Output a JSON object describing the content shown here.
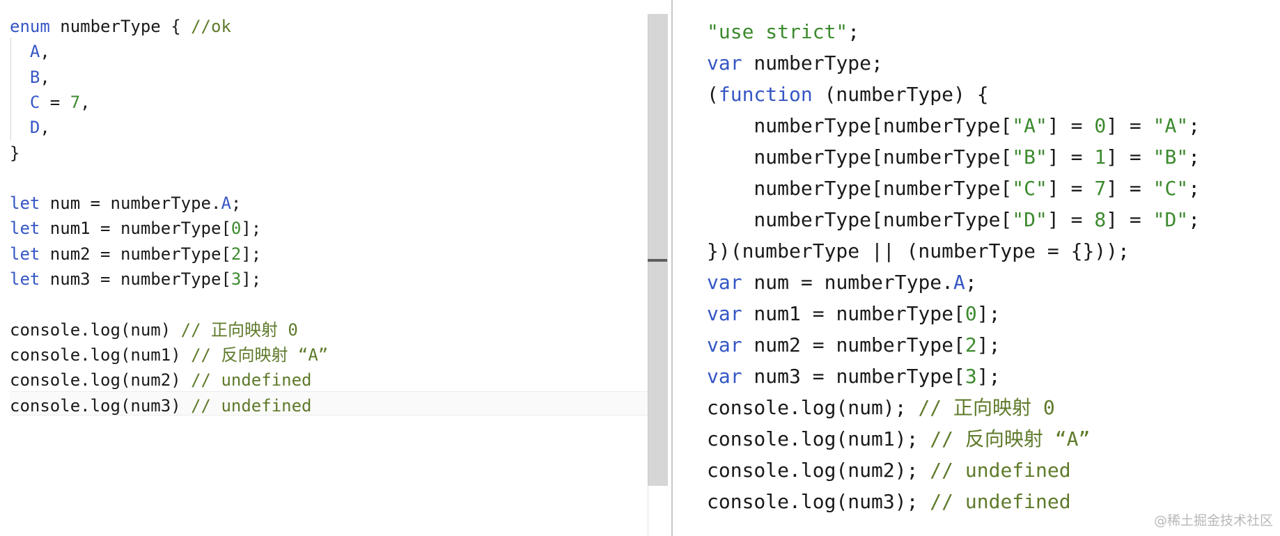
{
  "source_editor": {
    "lines": [
      [
        {
          "t": "enum",
          "c": "kw"
        },
        {
          "t": " numberType { "
        },
        {
          "t": "//ok",
          "c": "cm"
        }
      ],
      [
        {
          "t": "  "
        },
        {
          "t": "A",
          "c": "kw"
        },
        {
          "t": ","
        }
      ],
      [
        {
          "t": "  "
        },
        {
          "t": "B",
          "c": "kw"
        },
        {
          "t": ","
        }
      ],
      [
        {
          "t": "  "
        },
        {
          "t": "C",
          "c": "kw"
        },
        {
          "t": " = "
        },
        {
          "t": "7",
          "c": "num"
        },
        {
          "t": ","
        }
      ],
      [
        {
          "t": "  "
        },
        {
          "t": "D",
          "c": "kw"
        },
        {
          "t": ","
        }
      ],
      [
        {
          "t": "}"
        }
      ],
      [],
      [
        {
          "t": "let",
          "c": "kw"
        },
        {
          "t": " num = numberType."
        },
        {
          "t": "A",
          "c": "mem"
        },
        {
          "t": ";"
        }
      ],
      [
        {
          "t": "let",
          "c": "kw"
        },
        {
          "t": " num1 = numberType["
        },
        {
          "t": "0",
          "c": "num"
        },
        {
          "t": "];"
        }
      ],
      [
        {
          "t": "let",
          "c": "kw"
        },
        {
          "t": " num2 = numberType["
        },
        {
          "t": "2",
          "c": "num"
        },
        {
          "t": "];"
        }
      ],
      [
        {
          "t": "let",
          "c": "kw"
        },
        {
          "t": " num3 = numberType["
        },
        {
          "t": "3",
          "c": "num"
        },
        {
          "t": "];"
        }
      ],
      [],
      [
        {
          "t": "console.log(num) "
        },
        {
          "t": "// 正向映射 0",
          "c": "cm"
        }
      ],
      [
        {
          "t": "console.log(num1) "
        },
        {
          "t": "// 反向映射 “A”",
          "c": "cm"
        }
      ],
      [
        {
          "t": "console.log(num2) "
        },
        {
          "t": "// undefined",
          "c": "cm"
        }
      ],
      [
        {
          "t": "console.log(num3) "
        },
        {
          "t": "// undefined",
          "c": "cm"
        }
      ]
    ]
  },
  "compiled_output": {
    "lines": [
      [
        {
          "t": "\"use strict\"",
          "c": "str"
        },
        {
          "t": ";"
        }
      ],
      [
        {
          "t": "var",
          "c": "kw"
        },
        {
          "t": " numberType;"
        }
      ],
      [
        {
          "t": "("
        },
        {
          "t": "function",
          "c": "kw"
        },
        {
          "t": " (numberType) {"
        }
      ],
      [
        {
          "t": "    numberType[numberType["
        },
        {
          "t": "\"A\"",
          "c": "str"
        },
        {
          "t": "] = "
        },
        {
          "t": "0",
          "c": "num"
        },
        {
          "t": "] = "
        },
        {
          "t": "\"A\"",
          "c": "str"
        },
        {
          "t": ";"
        }
      ],
      [
        {
          "t": "    numberType[numberType["
        },
        {
          "t": "\"B\"",
          "c": "str"
        },
        {
          "t": "] = "
        },
        {
          "t": "1",
          "c": "num"
        },
        {
          "t": "] = "
        },
        {
          "t": "\"B\"",
          "c": "str"
        },
        {
          "t": ";"
        }
      ],
      [
        {
          "t": "    numberType[numberType["
        },
        {
          "t": "\"C\"",
          "c": "str"
        },
        {
          "t": "] = "
        },
        {
          "t": "7",
          "c": "num"
        },
        {
          "t": "] = "
        },
        {
          "t": "\"C\"",
          "c": "str"
        },
        {
          "t": ";"
        }
      ],
      [
        {
          "t": "    numberType[numberType["
        },
        {
          "t": "\"D\"",
          "c": "str"
        },
        {
          "t": "] = "
        },
        {
          "t": "8",
          "c": "num"
        },
        {
          "t": "] = "
        },
        {
          "t": "\"D\"",
          "c": "str"
        },
        {
          "t": ";"
        }
      ],
      [
        {
          "t": "})(numberType || (numberType = {}));"
        }
      ],
      [
        {
          "t": "var",
          "c": "kw"
        },
        {
          "t": " num = numberType."
        },
        {
          "t": "A",
          "c": "mem"
        },
        {
          "t": ";"
        }
      ],
      [
        {
          "t": "var",
          "c": "kw"
        },
        {
          "t": " num1 = numberType["
        },
        {
          "t": "0",
          "c": "num"
        },
        {
          "t": "];"
        }
      ],
      [
        {
          "t": "var",
          "c": "kw"
        },
        {
          "t": " num2 = numberType["
        },
        {
          "t": "2",
          "c": "num"
        },
        {
          "t": "];"
        }
      ],
      [
        {
          "t": "var",
          "c": "kw"
        },
        {
          "t": " num3 = numberType["
        },
        {
          "t": "3",
          "c": "num"
        },
        {
          "t": "];"
        }
      ],
      [
        {
          "t": "console.log(num); "
        },
        {
          "t": "// 正向映射 0",
          "c": "cm"
        }
      ],
      [
        {
          "t": "console.log(num1); "
        },
        {
          "t": "// 反向映射 “A”",
          "c": "cm"
        }
      ],
      [
        {
          "t": "console.log(num2); "
        },
        {
          "t": "// undefined",
          "c": "cm"
        }
      ],
      [
        {
          "t": "console.log(num3); "
        },
        {
          "t": "// undefined",
          "c": "cm"
        }
      ]
    ]
  },
  "watermark": "@稀土掘金技术社区",
  "colors": {
    "keyword": "#3556c4",
    "string": "#3c8a2e",
    "number": "#3c8a2e",
    "comment": "#5e7a2a",
    "text": "#1a1a1a"
  }
}
